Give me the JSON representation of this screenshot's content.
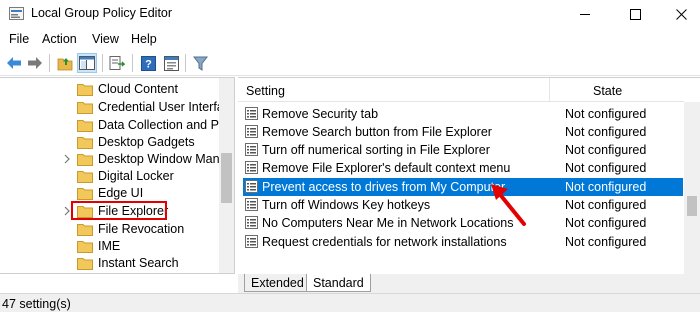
{
  "window": {
    "title": "Local Group Policy Editor"
  },
  "menu": [
    "File",
    "Action",
    "View",
    "Help"
  ],
  "toolbar": {
    "icons": [
      "back-arrow-icon",
      "forward-arrow-icon",
      "up-folder-icon",
      "show-hide-tree-icon",
      "export-list-icon",
      "help-icon",
      "properties-icon",
      "filter-icon"
    ]
  },
  "tree": {
    "items": [
      {
        "label": "Cloud Content",
        "expandable": false
      },
      {
        "label": "Credential User Interfac",
        "expandable": false
      },
      {
        "label": "Data Collection and Pre",
        "expandable": false
      },
      {
        "label": "Desktop Gadgets",
        "expandable": false
      },
      {
        "label": "Desktop Window Mana",
        "expandable": true
      },
      {
        "label": "Digital Locker",
        "expandable": false
      },
      {
        "label": "Edge UI",
        "expandable": false
      },
      {
        "label": "File Explorer",
        "expandable": true,
        "highlighted": true
      },
      {
        "label": "File Revocation",
        "expandable": false
      },
      {
        "label": "IME",
        "expandable": false
      },
      {
        "label": "Instant Search",
        "expandable": false
      }
    ]
  },
  "list": {
    "columns": {
      "setting": "Setting",
      "state": "State"
    },
    "rows": [
      {
        "setting": "Remove Security tab",
        "state": "Not configured",
        "selected": false
      },
      {
        "setting": "Remove Search button from File Explorer",
        "state": "Not configured",
        "selected": false
      },
      {
        "setting": "Turn off numerical sorting in File Explorer",
        "state": "Not configured",
        "selected": false
      },
      {
        "setting": "Remove File Explorer's default context menu",
        "state": "Not configured",
        "selected": false
      },
      {
        "setting": "Prevent access to drives from My Computer",
        "state": "Not configured",
        "selected": true
      },
      {
        "setting": "Turn off Windows Key hotkeys",
        "state": "Not configured",
        "selected": false
      },
      {
        "setting": "No Computers Near Me in Network Locations",
        "state": "Not configured",
        "selected": false
      },
      {
        "setting": "Request credentials for network installations",
        "state": "Not configured",
        "selected": false
      }
    ]
  },
  "tabs": [
    "Extended",
    "Standard"
  ],
  "status": {
    "text": "47 setting(s)"
  },
  "colors": {
    "selection": "#0078d7",
    "annotation": "#e30000",
    "folder": "#f3c85a"
  }
}
